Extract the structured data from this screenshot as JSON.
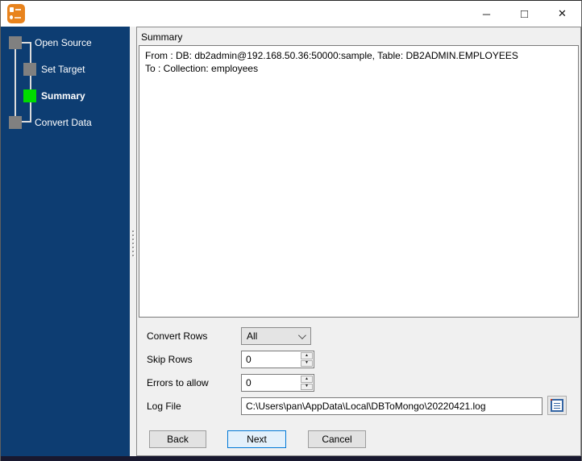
{
  "window": {
    "title": "",
    "controls": {
      "minimize": "─",
      "maximize": "□",
      "close": "✕"
    }
  },
  "icons": {
    "app": "dbtomongo-app-icon",
    "combo_chevron": "chevron-down",
    "spinner_up": "▲",
    "spinner_down": "▼",
    "log_browse": "view-log-file-document"
  },
  "sidebar": {
    "steps": [
      {
        "label": "Open Source",
        "current": false
      },
      {
        "label": "Set Target",
        "current": false
      },
      {
        "label": "Summary",
        "current": true
      },
      {
        "label": "Convert Data",
        "current": false
      }
    ]
  },
  "main": {
    "header": "Summary",
    "summary_lines": [
      "From : DB: db2admin@192.168.50.36:50000:sample, Table: DB2ADMIN.EMPLOYEES",
      "To : Collection: employees"
    ],
    "form": {
      "convert_rows": {
        "label": "Convert Rows",
        "value": "All"
      },
      "skip_rows": {
        "label": "Skip Rows",
        "value": "0"
      },
      "errors_to_allow": {
        "label": "Errors to allow",
        "value": "0"
      },
      "log_file": {
        "label": "Log File",
        "value": "C:\\Users\\pan\\AppData\\Local\\DBToMongo\\20220421.log"
      }
    },
    "buttons": {
      "back": "Back",
      "next": "Next",
      "cancel": "Cancel"
    }
  },
  "colors": {
    "sidebar_bg": "#0D3D72",
    "step_pending": "#808080",
    "step_current": "#00DC00",
    "accent_focus": "#0078D7",
    "app_icon_orange": "#E8831D",
    "bottom_strip": "#18182F"
  }
}
